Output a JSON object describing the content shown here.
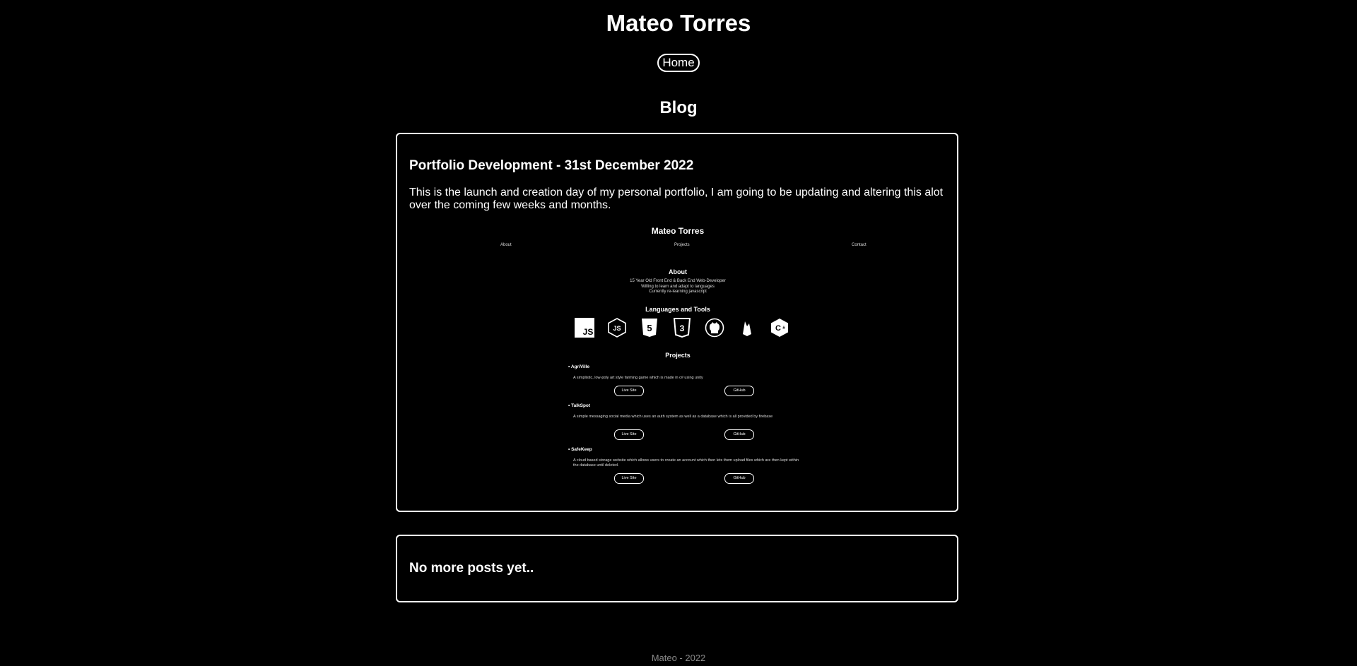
{
  "header": {
    "title": "Mateo Torres"
  },
  "nav": {
    "home_label": "Home"
  },
  "blog": {
    "section_title": "Blog",
    "posts": [
      {
        "title": "Portfolio Development - 31st December 2022",
        "body": "This is the launch and creation day of my personal portfolio, I am going to be updating and altering this alot over the coming few weeks and months.",
        "preview": {
          "title": "Mateo Torres",
          "nav": [
            "About",
            "Projects",
            "Contact"
          ],
          "about_heading": "About",
          "about_lines": [
            "15 Year Old Front End & Back End Web-Developer",
            "Willing to learn and adapt to languages",
            "Currently re-learning javascript"
          ],
          "languages_heading": "Languages and Tools",
          "icons": [
            "javascript-icon",
            "nodejs-icon",
            "html5-icon",
            "css3-icon",
            "github-icon",
            "firebase-icon",
            "csharp-icon"
          ],
          "projects_heading": "Projects",
          "projects": [
            {
              "name": "AgriVille",
              "description": "A simplistic, low-poly art style farming game which is made in c# using unity",
              "live_label": "Live Site",
              "github_label": "GitHub"
            },
            {
              "name": "TalkSpot",
              "description": "A simple messaging social media which uses an auth system as well as a database which is all provided by firebase",
              "live_label": "Live Site",
              "github_label": "GitHub"
            },
            {
              "name": "SafeKeep",
              "description": "A cloud based storage website which allows users to create an account which then lets them upload files which are then kept within the database until deleted.",
              "live_label": "Live Site",
              "github_label": "GitHub"
            }
          ]
        }
      }
    ],
    "empty_message": "No more posts yet.."
  },
  "footer": {
    "text": "Mateo - 2022"
  },
  "colors": {
    "background": "#000000",
    "text": "#ffffff",
    "footer_text": "#8a8a8a"
  }
}
